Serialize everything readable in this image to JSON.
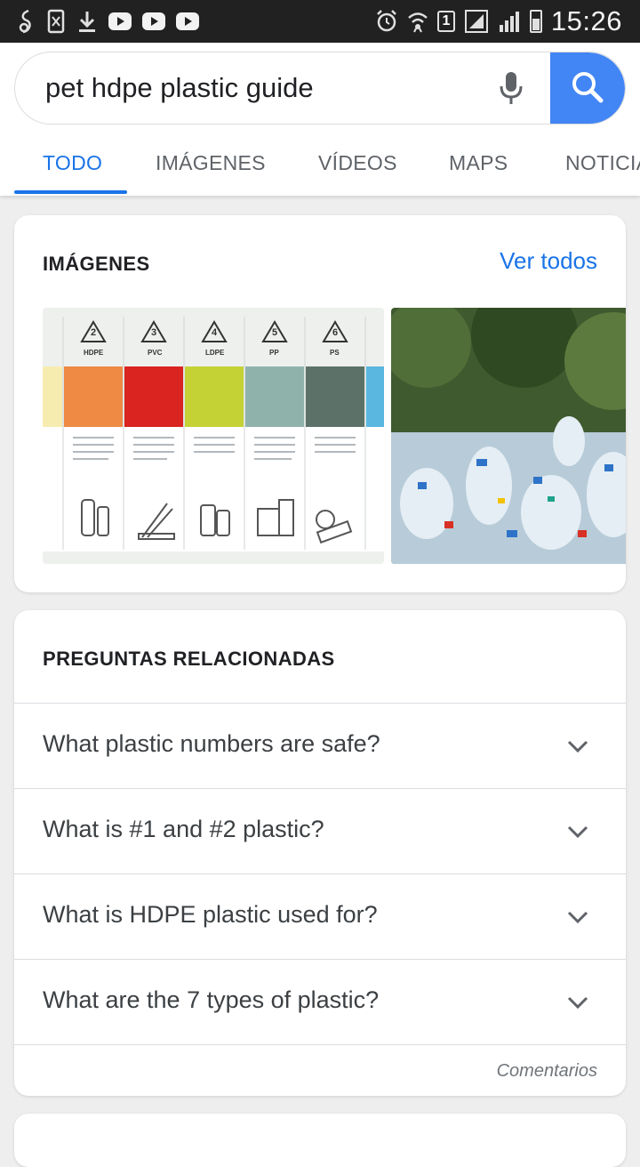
{
  "status_bar": {
    "time": "15:26",
    "sim_slot": "1"
  },
  "search": {
    "query": "pet hdpe plastic guide"
  },
  "tabs": [
    {
      "label": "TODO",
      "active": true
    },
    {
      "label": "IMÁGENES",
      "active": false
    },
    {
      "label": "VÍDEOS",
      "active": false
    },
    {
      "label": "MAPS",
      "active": false
    },
    {
      "label": "NOTICIAS",
      "active": false
    }
  ],
  "images_card": {
    "title": "IMÁGENES",
    "see_all": "Ver todos",
    "chart_labels": [
      "HDPE",
      "PVC",
      "LDPE",
      "PP",
      "PS"
    ],
    "chart_numbers": [
      "2",
      "3",
      "4",
      "5",
      "6"
    ]
  },
  "related_questions": {
    "title": "PREGUNTAS RELACIONADAS",
    "items": [
      {
        "question": "What plastic numbers are safe?"
      },
      {
        "question": "What is #1 and #2 plastic?"
      },
      {
        "question": "What is HDPE plastic used for?"
      },
      {
        "question": "What are the 7 types of plastic?"
      }
    ],
    "feedback": "Comentarios"
  },
  "colors": {
    "accent": "#1a73e8",
    "search_button": "#4285f4",
    "status_bar": "#212121"
  }
}
